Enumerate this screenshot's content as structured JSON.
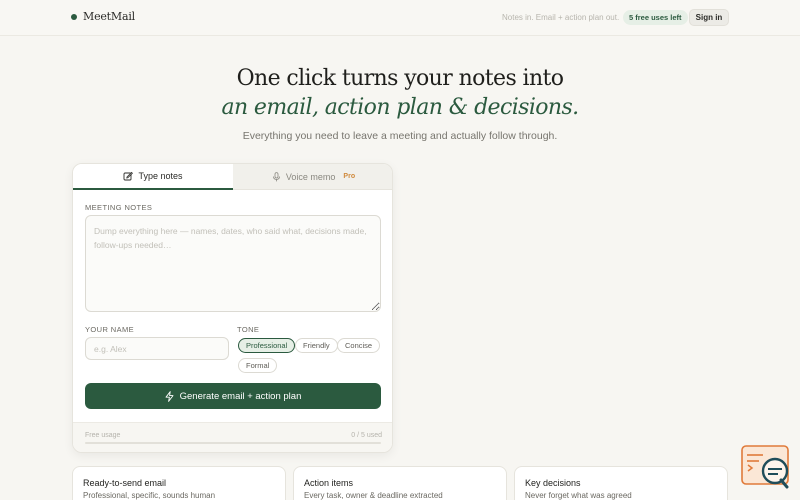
{
  "app": {
    "name": "MeetMail"
  },
  "header": {
    "tagline": "Notes in. Email + action plan out.",
    "uses_badge": "5 free uses left",
    "signin_label": "Sign in"
  },
  "hero": {
    "line1": "One click turns your notes into",
    "line2": "an email, action plan & decisions.",
    "subtitle": "Everything you need to leave a meeting and actually follow through."
  },
  "tabs": [
    {
      "label": "Type notes",
      "active": true
    },
    {
      "label": "Voice memo",
      "badge": "Pro",
      "active": false
    }
  ],
  "form": {
    "notes_label": "MEETING NOTES",
    "notes_placeholder": "Dump everything here — names, dates, who said what, decisions made, follow-ups needed…",
    "notes_value": "",
    "name_label": "YOUR NAME",
    "name_placeholder": "e.g. Alex",
    "name_value": "",
    "tone_label": "TONE",
    "tones": [
      "Professional",
      "Friendly",
      "Concise",
      "Formal"
    ],
    "selected_tone": "Professional",
    "generate_label": "Generate email + action plan"
  },
  "usage": {
    "label": "Free usage",
    "count_text": "0 / 5 used",
    "used": 0,
    "total": 5
  },
  "features": [
    {
      "title": "Ready-to-send email",
      "desc": "Professional, specific, sounds human"
    },
    {
      "title": "Action items",
      "desc": "Every task, owner & deadline extracted"
    },
    {
      "title": "Key decisions",
      "desc": "Never forget what was agreed"
    }
  ],
  "colors": {
    "brand": "#2b5a3f",
    "pro_badge": "#d08a3c",
    "chat_widget_bg": "#fbe7d6",
    "chat_widget_accent": "#1f4d5a"
  }
}
